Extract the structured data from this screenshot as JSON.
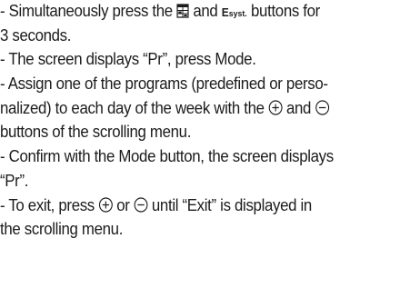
{
  "document": {
    "l1a": "- Simultaneously press the ",
    "l1b": " and ",
    "esyst_main": "E",
    "esyst_sub": "syst.",
    "l1c": " buttons for",
    "l2": "3 seconds.",
    "l3": "- The screen displays “Pr”, press Mode.",
    "l4": "- Assign one of the programs (predefined or perso-",
    "l5a": "nalized) to each day of the week with the ",
    "l5b": " and ",
    "l6": "buttons of the scrolling menu.",
    "l7": "- Confirm with the Mode button, the screen displays",
    "l8": "“Pr”.",
    "l9a": "- To exit, press ",
    "l9b": " or ",
    "l9c": " until “Exit” is displayed in",
    "l10": "the scrolling menu."
  },
  "icons": {
    "calendar": "calendar-program-icon",
    "plus": "plus-circle-icon",
    "minus": "minus-circle-icon"
  }
}
